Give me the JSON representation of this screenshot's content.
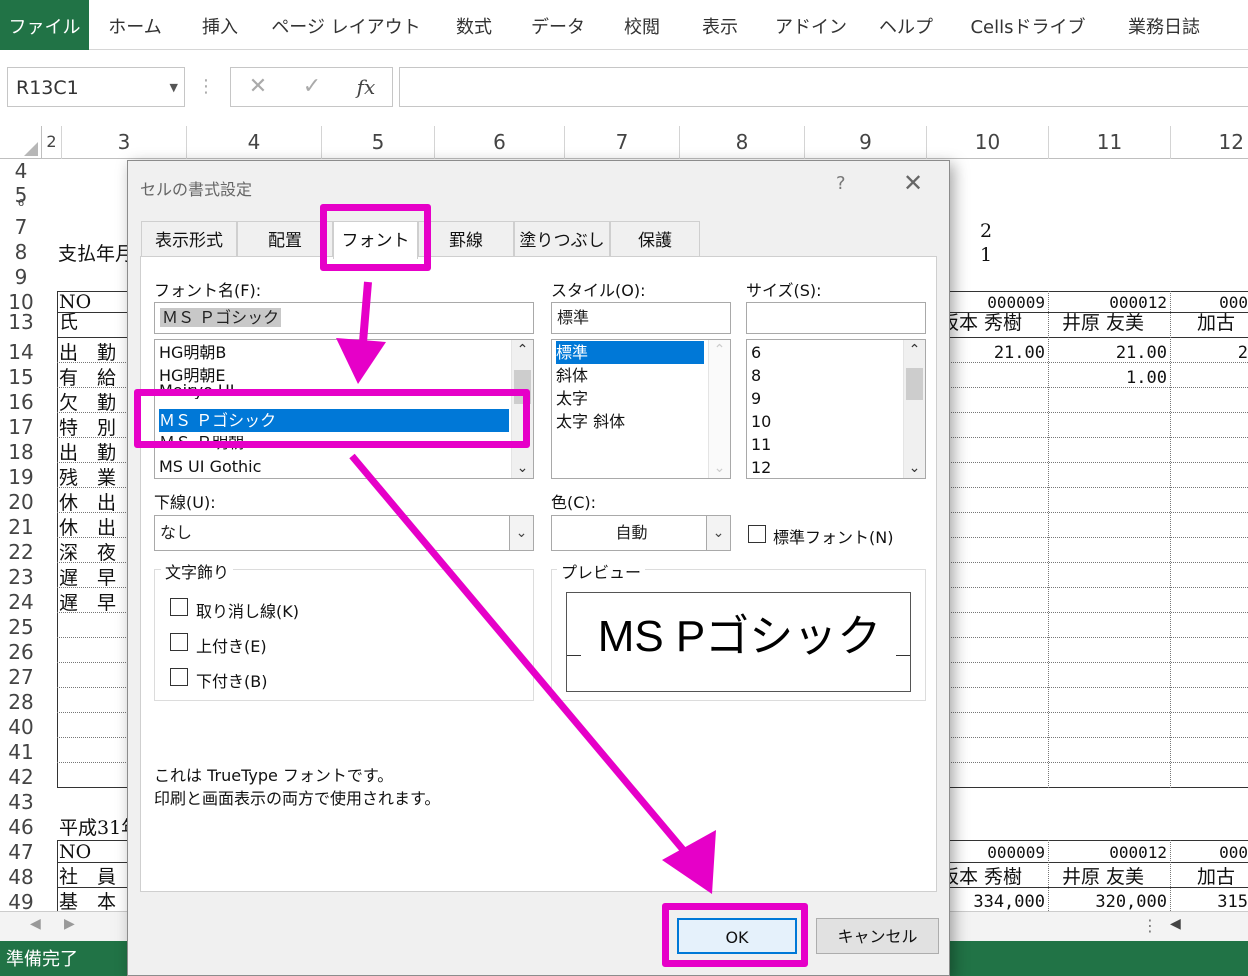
{
  "ribbon": {
    "tabs": [
      "ファイル",
      "ホーム",
      "挿入",
      "ページ レイアウト",
      "数式",
      "データ",
      "校閲",
      "表示",
      "アドイン",
      "ヘルプ",
      "Cellsドライブ",
      "業務日誌"
    ]
  },
  "formula_bar": {
    "name_box": "R13C1",
    "fx_label": "fx",
    "cancel_icon": "✕",
    "enter_icon": "✓",
    "more_icon": "⋮",
    "formula": ""
  },
  "columns": [
    "2",
    "3",
    "4",
    "5",
    "6",
    "7",
    "8",
    "9",
    "10",
    "11",
    "12"
  ],
  "rows": [
    "4",
    "5",
    "6",
    "7",
    "8",
    "9",
    "10",
    "13",
    "14",
    "15",
    "16",
    "17",
    "18",
    "19",
    "20",
    "21",
    "22",
    "23",
    "24",
    "25",
    "26",
    "27",
    "28",
    "40",
    "41",
    "42",
    "43",
    "46",
    "47",
    "48",
    "49"
  ],
  "sheet": {
    "title_left": "支払年月",
    "num_2": "2",
    "num_1": "1",
    "no_label": "NO",
    "name_label": "氏",
    "row_labels": [
      "出　勤",
      "有　給",
      "欠　勤",
      "特　別",
      "出　勤",
      "残　業",
      "休　出",
      "休　出",
      "深　夜",
      "遅　早",
      "遅　早"
    ],
    "col10_no": "000009",
    "col11_no": "000012",
    "col12_no": "000",
    "col10_name": "坂本 秀樹",
    "col11_name": "井原 友美",
    "col12_name": "加古",
    "col10_row14": "21.00",
    "col11_row14": "21.00",
    "col12_row14": "2",
    "col11_row15": "1.00",
    "bottom_title": "平成31年",
    "bottom_no": "NO",
    "bottom_emp": "社　員",
    "bottom_base": "基　本",
    "b_col10_no": "000009",
    "b_col11_no": "000012",
    "b_col12_no": "000",
    "b_col10_name": "坂本 秀樹",
    "b_col11_name": "井原 友美",
    "b_col12_name": "加古",
    "b_col10_val": "334,000",
    "b_col11_val": "320,000",
    "b_col12_val": "315"
  },
  "status": {
    "text": "準備完了"
  },
  "dialog": {
    "title": "セルの書式設定",
    "help": "?",
    "close": "✕",
    "tabs": [
      "表示形式",
      "配置",
      "フォント",
      "罫線",
      "塗りつぶし",
      "保護"
    ],
    "font_name_label": "フォント名(F):",
    "font_name_value": "ＭＳ Ｐゴシック",
    "font_list": [
      "HG明朝B",
      "HG明朝E",
      "Meiryo UI",
      "ＭＳ Ｐゴシック",
      "ＭＳ Ｐ明朝",
      "MS UI Gothic"
    ],
    "style_label": "スタイル(O):",
    "style_value": "標準",
    "style_list": [
      "標準",
      "斜体",
      "太字",
      "太字 斜体"
    ],
    "size_label": "サイズ(S):",
    "size_value": "",
    "size_list": [
      "6",
      "8",
      "9",
      "10",
      "11",
      "12"
    ],
    "underline_label": "下線(U):",
    "underline_value": "なし",
    "color_label": "色(C):",
    "color_value": "自動",
    "normal_font_label": "標準フォント(N)",
    "effects_label": "文字飾り",
    "strike_label": "取り消し線(K)",
    "super_label": "上付き(E)",
    "sub_label": "下付き(B)",
    "preview_label": "プレビュー",
    "preview_text": "MS Pゴシック",
    "info_line1": "これは TrueType フォントです。",
    "info_line2": "印刷と画面表示の両方で使用されます。",
    "ok": "OK",
    "cancel": "キャンセル"
  },
  "colors": {
    "accent": "#217346",
    "highlight": "#e600c8",
    "selection": "#0078d7"
  }
}
